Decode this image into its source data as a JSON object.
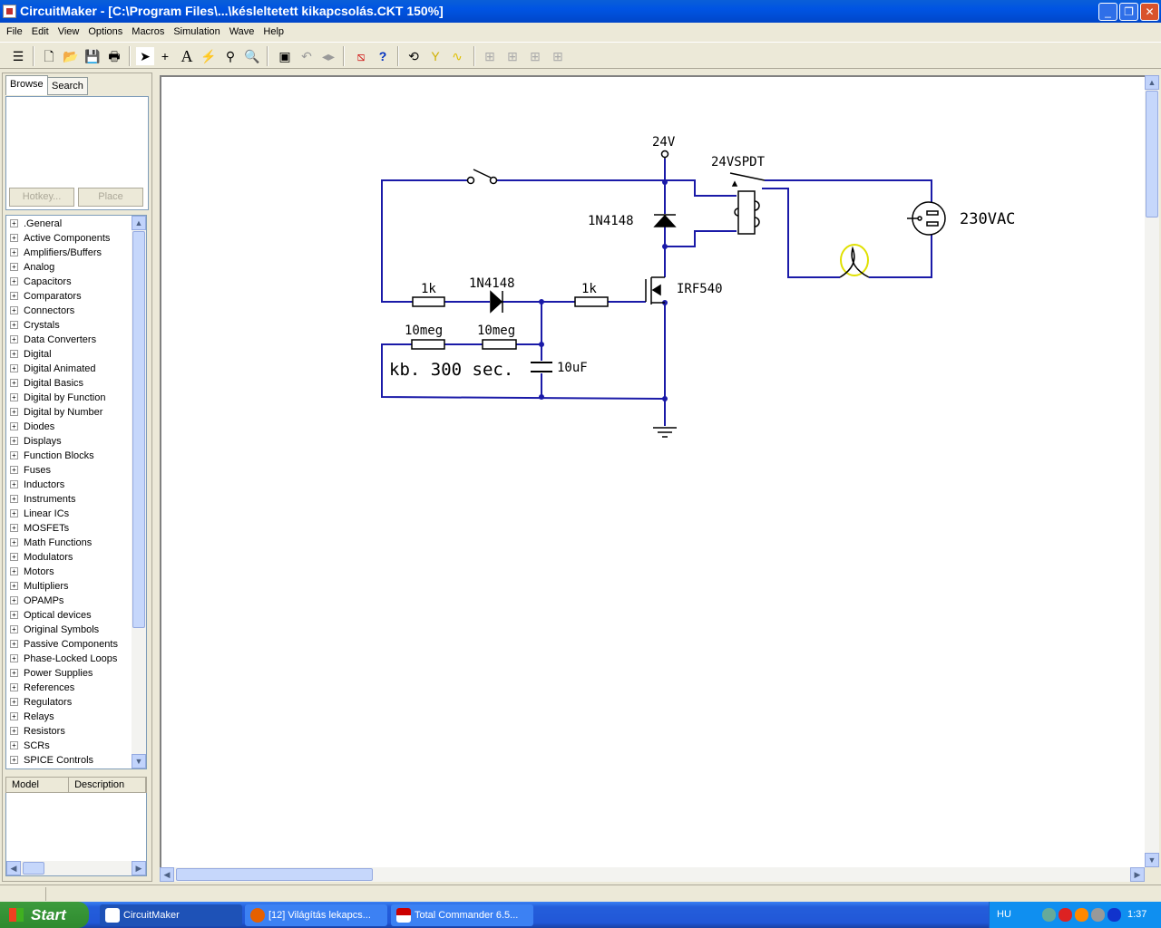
{
  "window": {
    "title": "CircuitMaker - [C:\\Program Files\\...\\késleltetett kikapcsolás.CKT 150%]"
  },
  "menu": [
    "File",
    "Edit",
    "View",
    "Options",
    "Macros",
    "Simulation",
    "Wave",
    "Help"
  ],
  "toolbar": {
    "icons": [
      "parts-icon",
      "new-icon",
      "open-icon",
      "save-icon",
      "print-icon",
      "arrow-icon",
      "wire-icon",
      "text-icon",
      "probe-icon",
      "pin-icon",
      "zoom-icon",
      "fit-icon",
      "rotate-icon",
      "mirror-icon",
      "netlist-icon",
      "help-icon",
      "reset-icon",
      "tune-icon",
      "step-icon",
      "ic1-icon",
      "ic2-icon",
      "ic3-icon",
      "ic4-icon"
    ]
  },
  "panel": {
    "tabs": [
      "Browse",
      "Search"
    ],
    "hotkey": "Hotkey...",
    "place": "Place",
    "tree": [
      ".General",
      "Active Components",
      "Amplifiers/Buffers",
      "Analog",
      "Capacitors",
      "Comparators",
      "Connectors",
      "Crystals",
      "Data Converters",
      "Digital",
      "Digital Animated",
      "Digital Basics",
      "Digital by Function",
      "Digital by Number",
      "Diodes",
      "Displays",
      "Function Blocks",
      "Fuses",
      "Inductors",
      "Instruments",
      "Linear ICs",
      "MOSFETs",
      "Math Functions",
      "Modulators",
      "Motors",
      "Multipliers",
      "OPAMPs",
      "Optical devices",
      "Original Symbols",
      "Passive Components",
      "Phase-Locked Loops",
      "Power Supplies",
      "References",
      "Regulators",
      "Relays",
      "Resistors",
      "SCRs",
      "SPICE Controls"
    ],
    "model_col": "Model",
    "desc_col": "Description"
  },
  "schematic": {
    "vcc": "24V",
    "relay": "24VSPDT",
    "diode1": "1N4148",
    "diode2": "1N4148",
    "r1": "1k",
    "r2": "1k",
    "r3": "10meg",
    "r4": "10meg",
    "cap": "10uF",
    "mosfet": "IRF540",
    "source": "230VAC",
    "note": "kb. 300 sec.",
    "wire_color": "#1a1aa8"
  },
  "taskbar": {
    "start": "Start",
    "tasks": [
      "CircuitMaker",
      "[12] Világítás lekapcs...",
      "Total Commander 6.5..."
    ],
    "lang": "HU",
    "clock": "1:37"
  }
}
